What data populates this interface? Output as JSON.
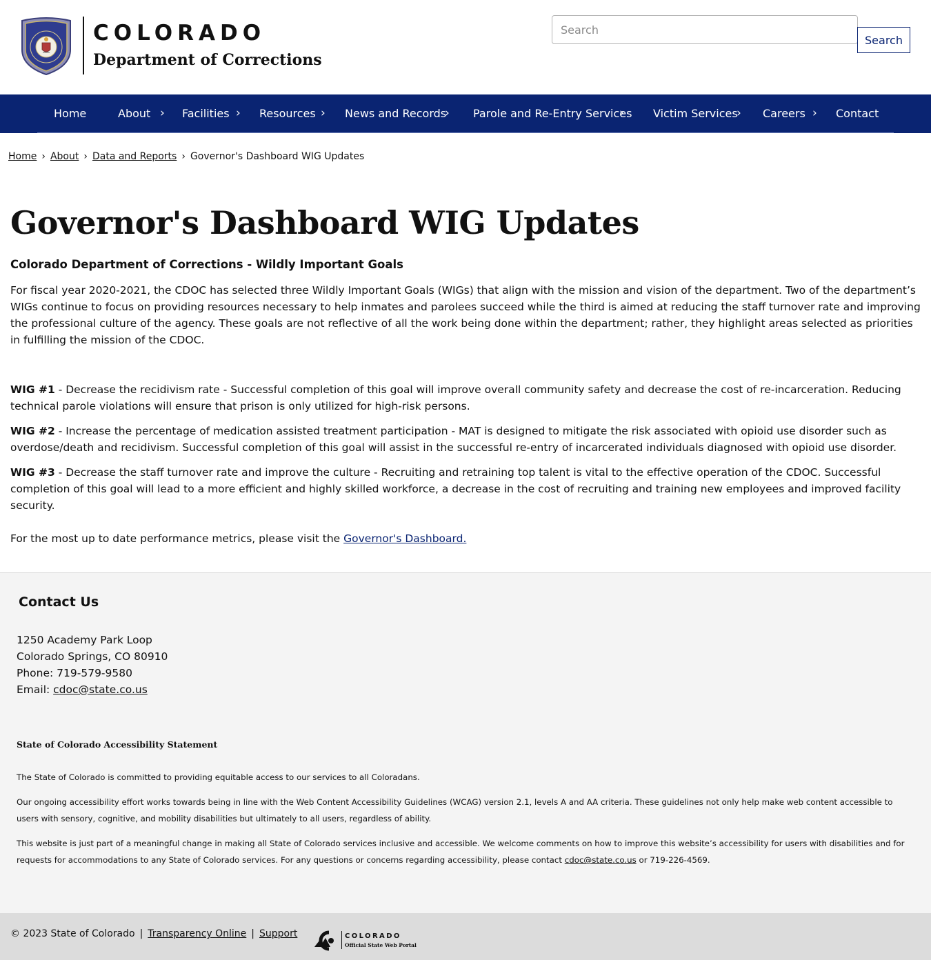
{
  "header": {
    "logo_state": "COLORADO",
    "logo_department": "Department of Corrections",
    "seal_text": "COLORADO DEPARTMENT OF CORRECTIONS",
    "search_placeholder": "Search",
    "search_button": "Search"
  },
  "nav": {
    "items": [
      {
        "label": "Home",
        "has_submenu": false
      },
      {
        "label": "About",
        "has_submenu": true
      },
      {
        "label": "Facilities",
        "has_submenu": true
      },
      {
        "label": "Resources",
        "has_submenu": true
      },
      {
        "label": "News and Records",
        "has_submenu": true
      },
      {
        "label": "Parole and Re-Entry Services",
        "has_submenu": true
      },
      {
        "label": "Victim Services",
        "has_submenu": true
      },
      {
        "label": "Careers",
        "has_submenu": true
      },
      {
        "label": "Contact",
        "has_submenu": false
      }
    ],
    "chevron": "›"
  },
  "breadcrumb": {
    "items": [
      "Home",
      "About",
      "Data and Reports"
    ],
    "current": "Governor's Dashboard WIG Updates",
    "separator": "›"
  },
  "main": {
    "title": "Governor's Dashboard WIG Updates",
    "subtitle": "Colorado Department of Corrections - Wildly Important Goals",
    "intro": "For fiscal year 2020-2021, the CDOC has selected three Wildly Important Goals (WIGs) that align with the mission and vision of the department. Two of the department’s WIGs continue to focus on providing resources necessary to help inmates and parolees succeed while the third is aimed at reducing the staff turnover rate and improving the professional culture of the agency. These goals are not reflective of all the work being done within the department; rather, they highlight areas selected as priorities in fulfilling the mission of the CDOC.",
    "wigs": [
      {
        "label": "WIG #1",
        "text": " - Decrease the recidivism rate - Successful completion of this goal will improve overall community safety and decrease the cost of re-incarceration. Reducing technical parole violations will ensure that prison is only utilized for high-risk persons."
      },
      {
        "label": "WIG #2",
        "text": " - Increase the percentage of medication assisted treatment participation - MAT is designed to mitigate the risk associated with opioid use disorder such as overdose/death and recidivism. Successful completion of this goal will assist in the successful re-entry of incarcerated individuals diagnosed with opioid use disorder."
      },
      {
        "label": "WIG #3",
        "text": " - Decrease the staff turnover rate and improve the culture - Recruiting and retraining top talent is vital to the effective operation of the CDOC. Successful completion of this goal will lead to a more efficient and highly skilled workforce, a decrease in the cost of recruiting and training new employees and improved facility security."
      }
    ],
    "metrics_text": "For the most up to date performance metrics, please visit the ",
    "metrics_link": "Governor's Dashboard."
  },
  "footer": {
    "contact_heading": "Contact Us",
    "address_line1": "1250 Academy Park Loop",
    "address_line2": "Colorado Springs, CO 80910",
    "phone": "Phone: 719-579-9580",
    "email_label": "Email: ",
    "email": "cdoc@state.co.us",
    "accessibility_heading": "State of Colorado Accessibility Statement",
    "acc_p1": "The State of Colorado is committed to providing equitable access to our services to all Coloradans.",
    "acc_p2": "Our ongoing accessibility effort works towards being in line with the Web Content Accessibility Guidelines (WCAG) version 2.1, levels A and AA criteria. These guidelines not only help make web content accessible to users with sensory, cognitive, and mobility disabilities but ultimately to all users, regardless of ability.",
    "acc_p3_before": "This website is just part of a meaningful change in making all State of Colorado services inclusive and accessible. We welcome comments on how to improve this website’s accessibility for users with disabilities and for requests for accommodations to any State of Colorado services. For any questions or concerns regarding accessibility, please contact ",
    "acc_p3_email": "cdoc@state.co.us",
    "acc_p3_after": " or 719-226-4569.",
    "copyright": "© 2023 State of Colorado",
    "pipe": "|",
    "transparency": "Transparency Online",
    "support": "Support",
    "portal_name": "COLORADO",
    "portal_sub": "Official State Web Portal"
  },
  "colors": {
    "nav_bg": "#0a2472",
    "link": "#0a2472",
    "footer_bg": "#f4f4f4",
    "bottom_bar_bg": "#dcdcdc"
  }
}
